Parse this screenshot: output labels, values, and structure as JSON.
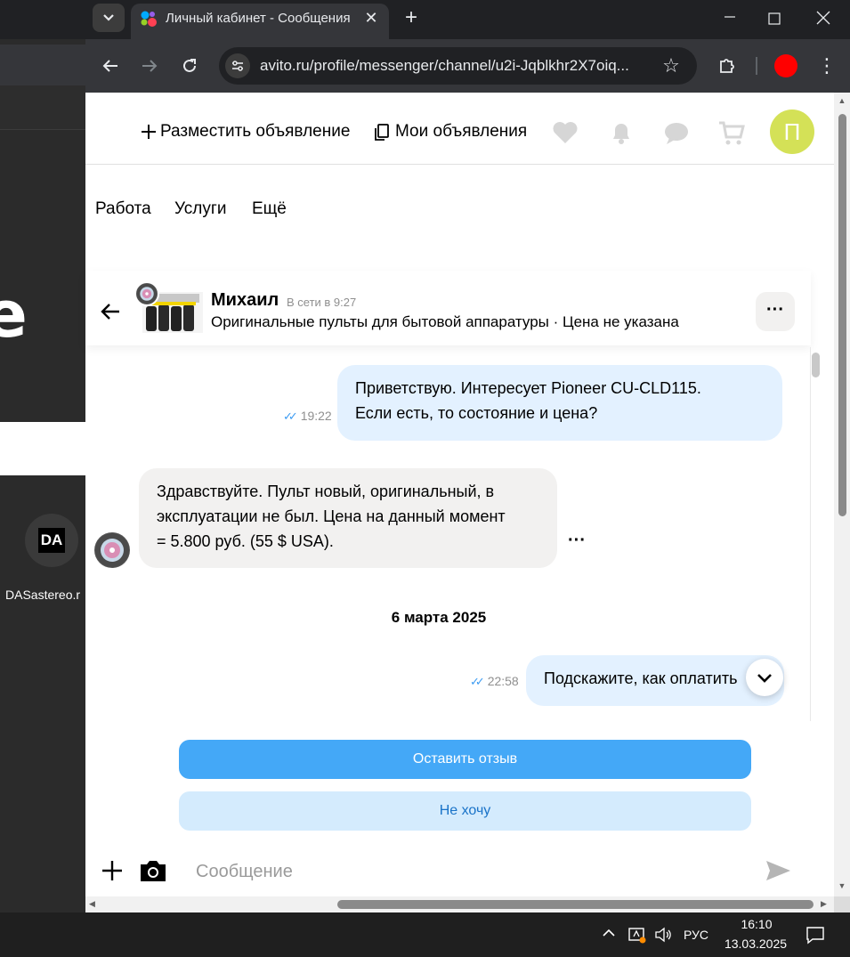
{
  "desktop": {
    "big_letter": "e",
    "icon_logo": "DA",
    "icon_label": "DASastereo.r"
  },
  "browser": {
    "tab_title": "Личный кабинет - Сообщения",
    "tab_close": "✕",
    "new_tab": "+",
    "url": "avito.ru/profile/messenger/channel/u2i-Jqblkhr2X7oiq...",
    "profile_color": "#ff0000",
    "icons": [
      "chevron-down-icon",
      "back-arrow-icon",
      "forward-arrow-icon",
      "reload-icon",
      "site-info-icon",
      "star-icon",
      "extensions-icon",
      "menu-icon"
    ]
  },
  "header": {
    "post_ad": "Разместить объявление",
    "my_ads": "Мои объявления",
    "avatar_letter": "П",
    "avatar_color": "#d4e157"
  },
  "categories": [
    "Работа",
    "Услуги",
    "Ещё"
  ],
  "chat": {
    "seller_name": "Михаил",
    "seller_status": "В сети в 9:27",
    "item_title": "Оригинальные пульты для бытовой аппаратуры · Цена не указана",
    "more": "···",
    "messages": [
      {
        "direction": "out",
        "text_line1": "Приветствую. Интересует Pioneer CU-CLD115.",
        "text_line2": "Если есть, то состояние и цена?",
        "time": "19:22"
      },
      {
        "direction": "in",
        "text_line1": "Здравствуйте. Пульт новый, оригинальный, в",
        "text_line2": "эксплуатации не был. Цена на данный момент",
        "text_line3": "= 5.800 руб. (55 $ USA).",
        "more": "···"
      },
      {
        "direction": "out",
        "text": "Подскажите, как оплатить",
        "time": "22:58"
      }
    ],
    "date_separator": "6 марта 2025"
  },
  "footer": {
    "review_button": "Оставить отзыв",
    "no_button": "Не хочу",
    "input_placeholder": "Сообщение"
  },
  "taskbar": {
    "lang": "РУС",
    "time": "16:10",
    "date": "13.03.2025"
  },
  "colors": {
    "accent": "#44a8f7",
    "outgoing_bubble": "#e3f1ff",
    "incoming_bubble": "#f2f1f0",
    "read_checks": "#3d9cf2"
  }
}
